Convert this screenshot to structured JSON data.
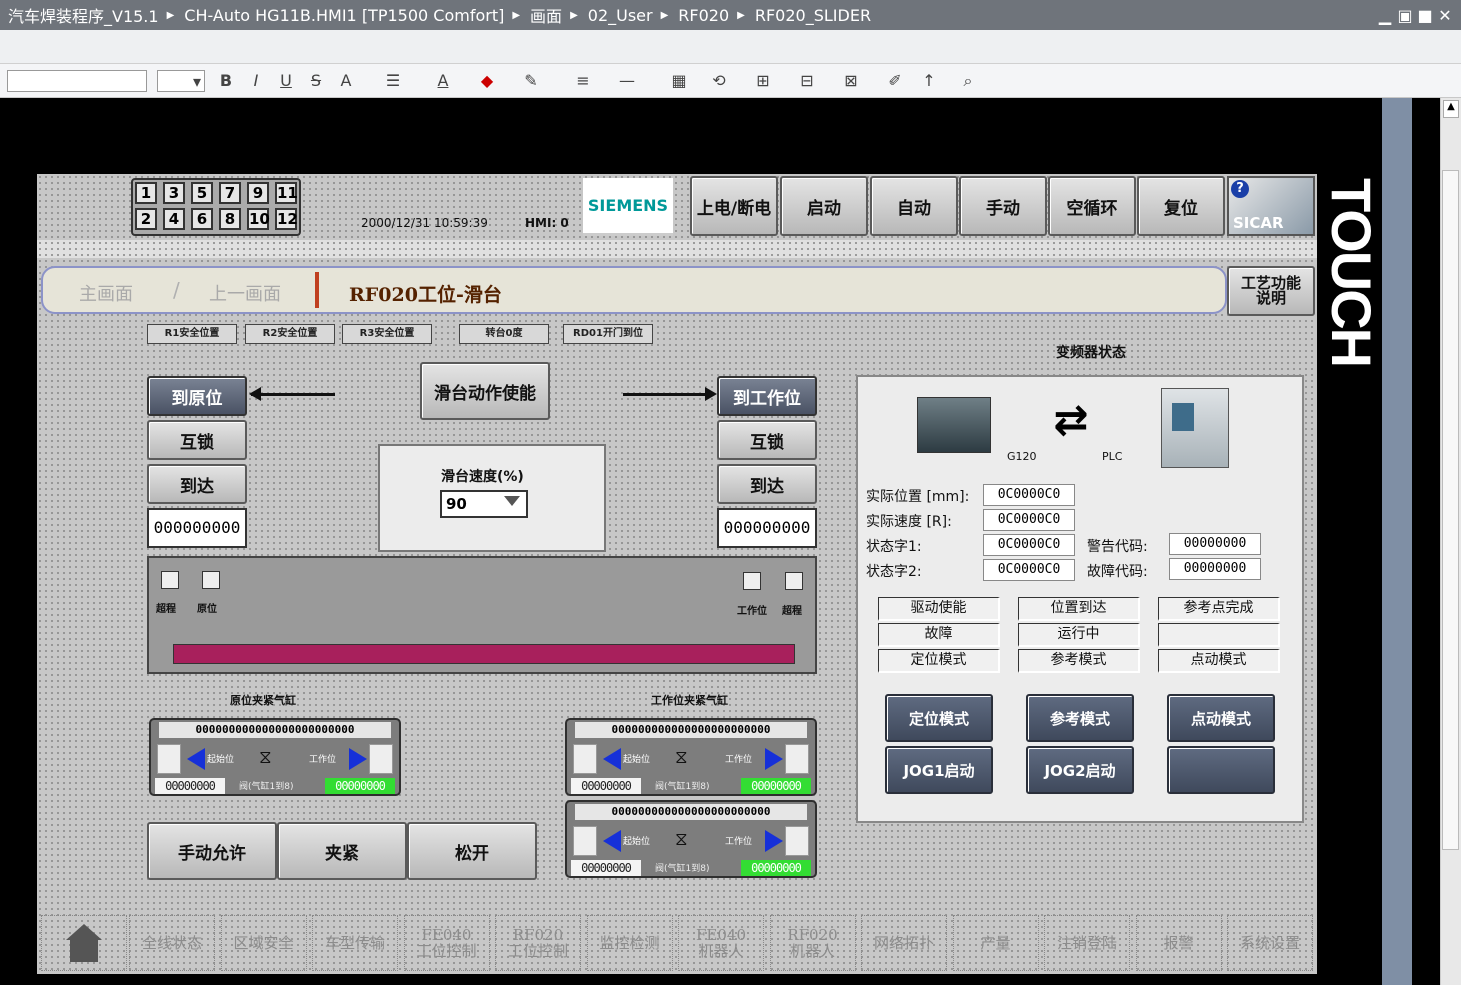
{
  "window": {
    "breadcrumb": [
      "汽车焊装程序_V15.1",
      "CH-Auto HG11B.HMI1 [TP1500 Comfort]",
      "画面",
      "02_User",
      "RF020",
      "RF020_SLIDER"
    ],
    "controls": [
      "▁",
      "▣",
      "■",
      "✕"
    ]
  },
  "toolbar": {
    "items": [
      "B",
      "I",
      "U",
      "S",
      "A",
      "A",
      "A",
      "A"
    ]
  },
  "header": {
    "num_keys_top": [
      "1",
      "3",
      "5",
      "7",
      "9",
      "11"
    ],
    "num_keys_bottom": [
      "2",
      "4",
      "6",
      "8",
      "10",
      "12"
    ],
    "datetime": "2000/12/31 10:59:39",
    "hmi_label": "HMI: 0",
    "siemens": "SIEMENS",
    "buttons": [
      "上电/断电",
      "启动",
      "自动",
      "手动",
      "空循环",
      "复位"
    ],
    "sicar": "SICAR"
  },
  "touch_label": "TOUCH",
  "breadcrumb_bar": {
    "main": "主画面",
    "prev": "上一画面",
    "title": "RF020工位-滑台",
    "help_btn": "工艺功能说明"
  },
  "safety_tags": [
    "R1安全位置",
    "R2安全位置",
    "R3安全位置",
    "转台0度",
    "RD01开门到位"
  ],
  "slider": {
    "enable_btn": "滑台动作使能",
    "to_origin": "到原位",
    "to_work": "到工作位",
    "interlock": "互锁",
    "arrived": "到达",
    "counter_left": "000000000",
    "counter_right": "000000000",
    "speed_label": "滑台速度(%)",
    "speed_value": "90",
    "sensors_left": [
      "超程",
      "原位"
    ],
    "sensors_right": [
      "工作位",
      "超程"
    ]
  },
  "cylinders": {
    "left_title": "原位夹紧气缸",
    "right_title": "工作位夹紧气缸",
    "top_value": "000000000000000000000000",
    "bottom_left": "00000000",
    "bottom_right": "00000000",
    "start_label": "起始位",
    "work_label": "工作位",
    "note": "阀(气缸1到8)"
  },
  "actions": [
    "手动允许",
    "夹紧",
    "松开"
  ],
  "vfd": {
    "title": "变频器状态",
    "g120": "G120",
    "plc": "PLC",
    "rows": [
      {
        "label": "实际位置 [mm]:",
        "value": "0C0000C0"
      },
      {
        "label": "实际速度 [R]:",
        "value": "0C0000C0"
      },
      {
        "label": "状态字1:",
        "value": "0C0000C0"
      },
      {
        "label": "状态字2:",
        "value": "0C0000C0"
      }
    ],
    "warn_label": "警告代码:",
    "warn_value": "00000000",
    "fault_label": "故障代码:",
    "fault_value": "00000000",
    "status_cells": [
      "驱动使能",
      "位置到达",
      "参考点完成",
      "故障",
      "运行中",
      "",
      "定位模式",
      "参考模式",
      "点动模式"
    ],
    "buttons": [
      "定位模式",
      "参考模式",
      "点动模式",
      "JOG1启动",
      "JOG2启动",
      ""
    ]
  },
  "nav": [
    "全线状态",
    "区域安全",
    "车型传输",
    "FE040\n工位控制",
    "RF020\n工位控制",
    "监控检测",
    "FE040\n机器人",
    "RF020\n机器人",
    "网络拓扑",
    "产量",
    "注销登陆",
    "报警",
    "系统设置"
  ]
}
